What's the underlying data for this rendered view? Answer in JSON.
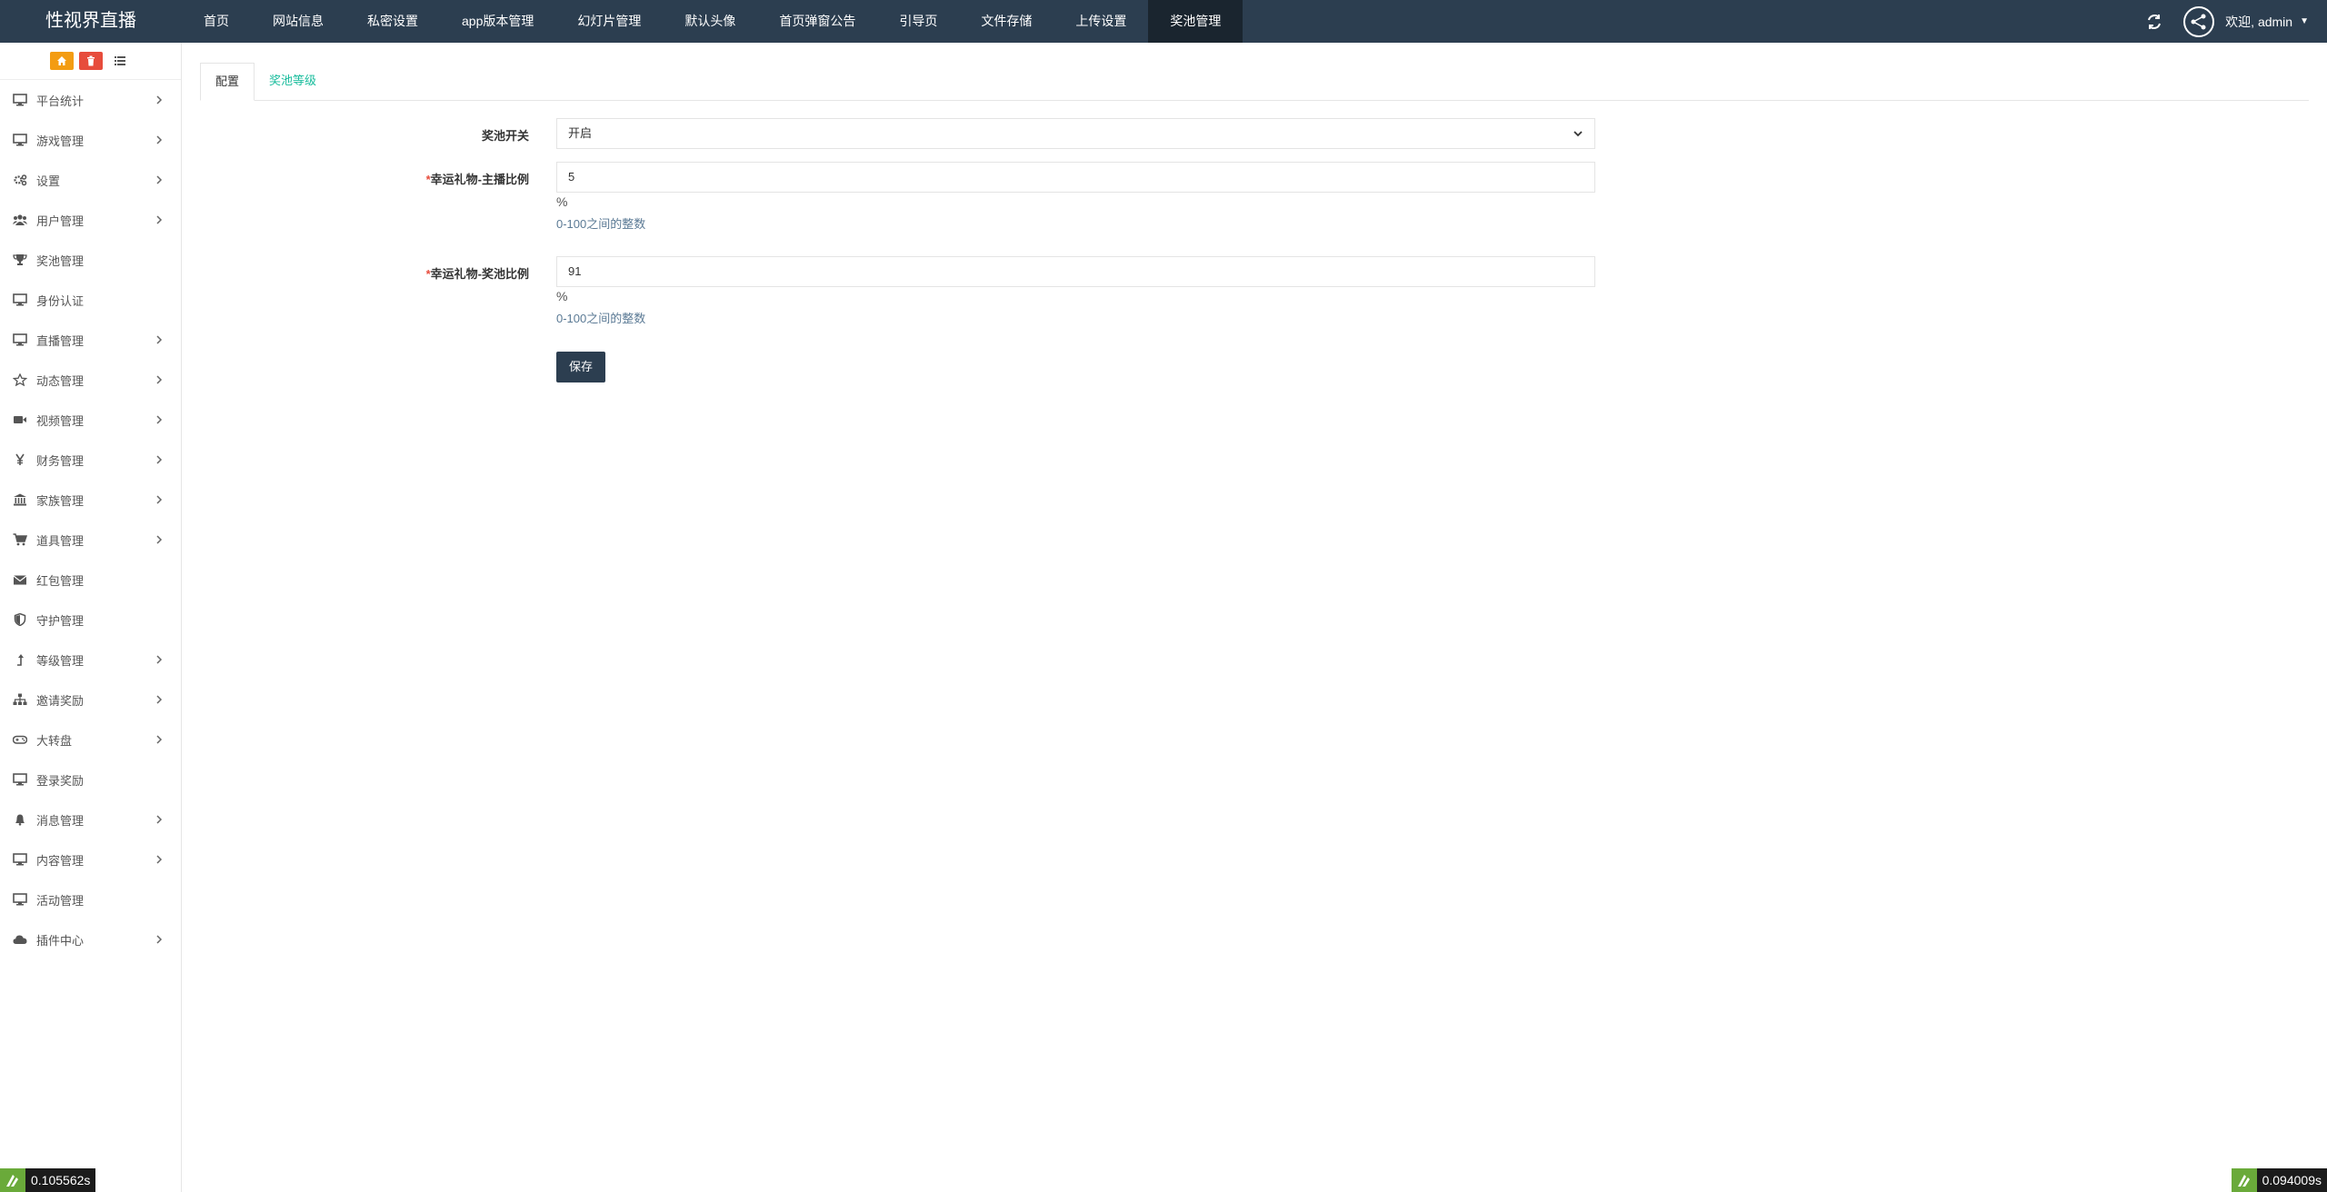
{
  "brand": {
    "name": "性视界直播"
  },
  "topnav": {
    "items": [
      "首页",
      "网站信息",
      "私密设置",
      "app版本管理",
      "幻灯片管理",
      "默认头像",
      "首页弹窗公告",
      "引导页",
      "文件存储",
      "上传设置",
      "奖池管理"
    ],
    "active_index": 10
  },
  "user": {
    "greeting": "欢迎, admin"
  },
  "icons": {
    "refresh": "refresh-icon",
    "avatar": "share-nodes-icon",
    "home": "home-icon",
    "trash": "trash-icon",
    "list": "list-icon"
  },
  "sidebar": {
    "items": [
      {
        "label": "平台统计",
        "icon": "desktop-icon",
        "has_children": true
      },
      {
        "label": "游戏管理",
        "icon": "desktop-icon",
        "has_children": true
      },
      {
        "label": "设置",
        "icon": "cogs-icon",
        "has_children": true
      },
      {
        "label": "用户管理",
        "icon": "users-icon",
        "has_children": true
      },
      {
        "label": "奖池管理",
        "icon": "trophy-icon",
        "has_children": false
      },
      {
        "label": "身份认证",
        "icon": "desktop-icon",
        "has_children": false
      },
      {
        "label": "直播管理",
        "icon": "desktop-icon",
        "has_children": true
      },
      {
        "label": "动态管理",
        "icon": "star-icon",
        "has_children": true
      },
      {
        "label": "视频管理",
        "icon": "video-icon",
        "has_children": true
      },
      {
        "label": "财务管理",
        "icon": "yen-icon",
        "has_children": true
      },
      {
        "label": "家族管理",
        "icon": "bank-icon",
        "has_children": true
      },
      {
        "label": "道具管理",
        "icon": "cart-icon",
        "has_children": true
      },
      {
        "label": "红包管理",
        "icon": "envelope-icon",
        "has_children": false
      },
      {
        "label": "守护管理",
        "icon": "shield-icon",
        "has_children": false
      },
      {
        "label": "等级管理",
        "icon": "level-up-icon",
        "has_children": true
      },
      {
        "label": "邀请奖励",
        "icon": "sitemap-icon",
        "has_children": true
      },
      {
        "label": "大转盘",
        "icon": "gamepad-icon",
        "has_children": true
      },
      {
        "label": "登录奖励",
        "icon": "desktop-icon",
        "has_children": false
      },
      {
        "label": "消息管理",
        "icon": "bell-icon",
        "has_children": true
      },
      {
        "label": "内容管理",
        "icon": "desktop-icon",
        "has_children": true
      },
      {
        "label": "活动管理",
        "icon": "desktop-icon",
        "has_children": false
      },
      {
        "label": "插件中心",
        "icon": "cloud-icon",
        "has_children": true
      }
    ]
  },
  "tabs": [
    {
      "label": "配置",
      "active": true
    },
    {
      "label": "奖池等级",
      "active": false
    }
  ],
  "form": {
    "switch": {
      "label": "奖池开关",
      "value": "开启",
      "required": false
    },
    "anchor_ratio": {
      "label": "幸运礼物-主播比例",
      "value": "5",
      "unit": "%",
      "help": "0-100之间的整数",
      "required": true
    },
    "pool_ratio": {
      "label": "幸运礼物-奖池比例",
      "value": "91",
      "unit": "%",
      "help": "0-100之间的整数",
      "required": true
    },
    "required_mark": "*",
    "save_label": "保存"
  },
  "debug": {
    "left_time": "0.105562s",
    "right_time": "0.094009s"
  },
  "colors": {
    "navbar": "#2c3e50",
    "navbar_active": "#1a252f",
    "accent": "#18bc9c",
    "danger": "#e74c3c",
    "warning": "#f39c12"
  }
}
